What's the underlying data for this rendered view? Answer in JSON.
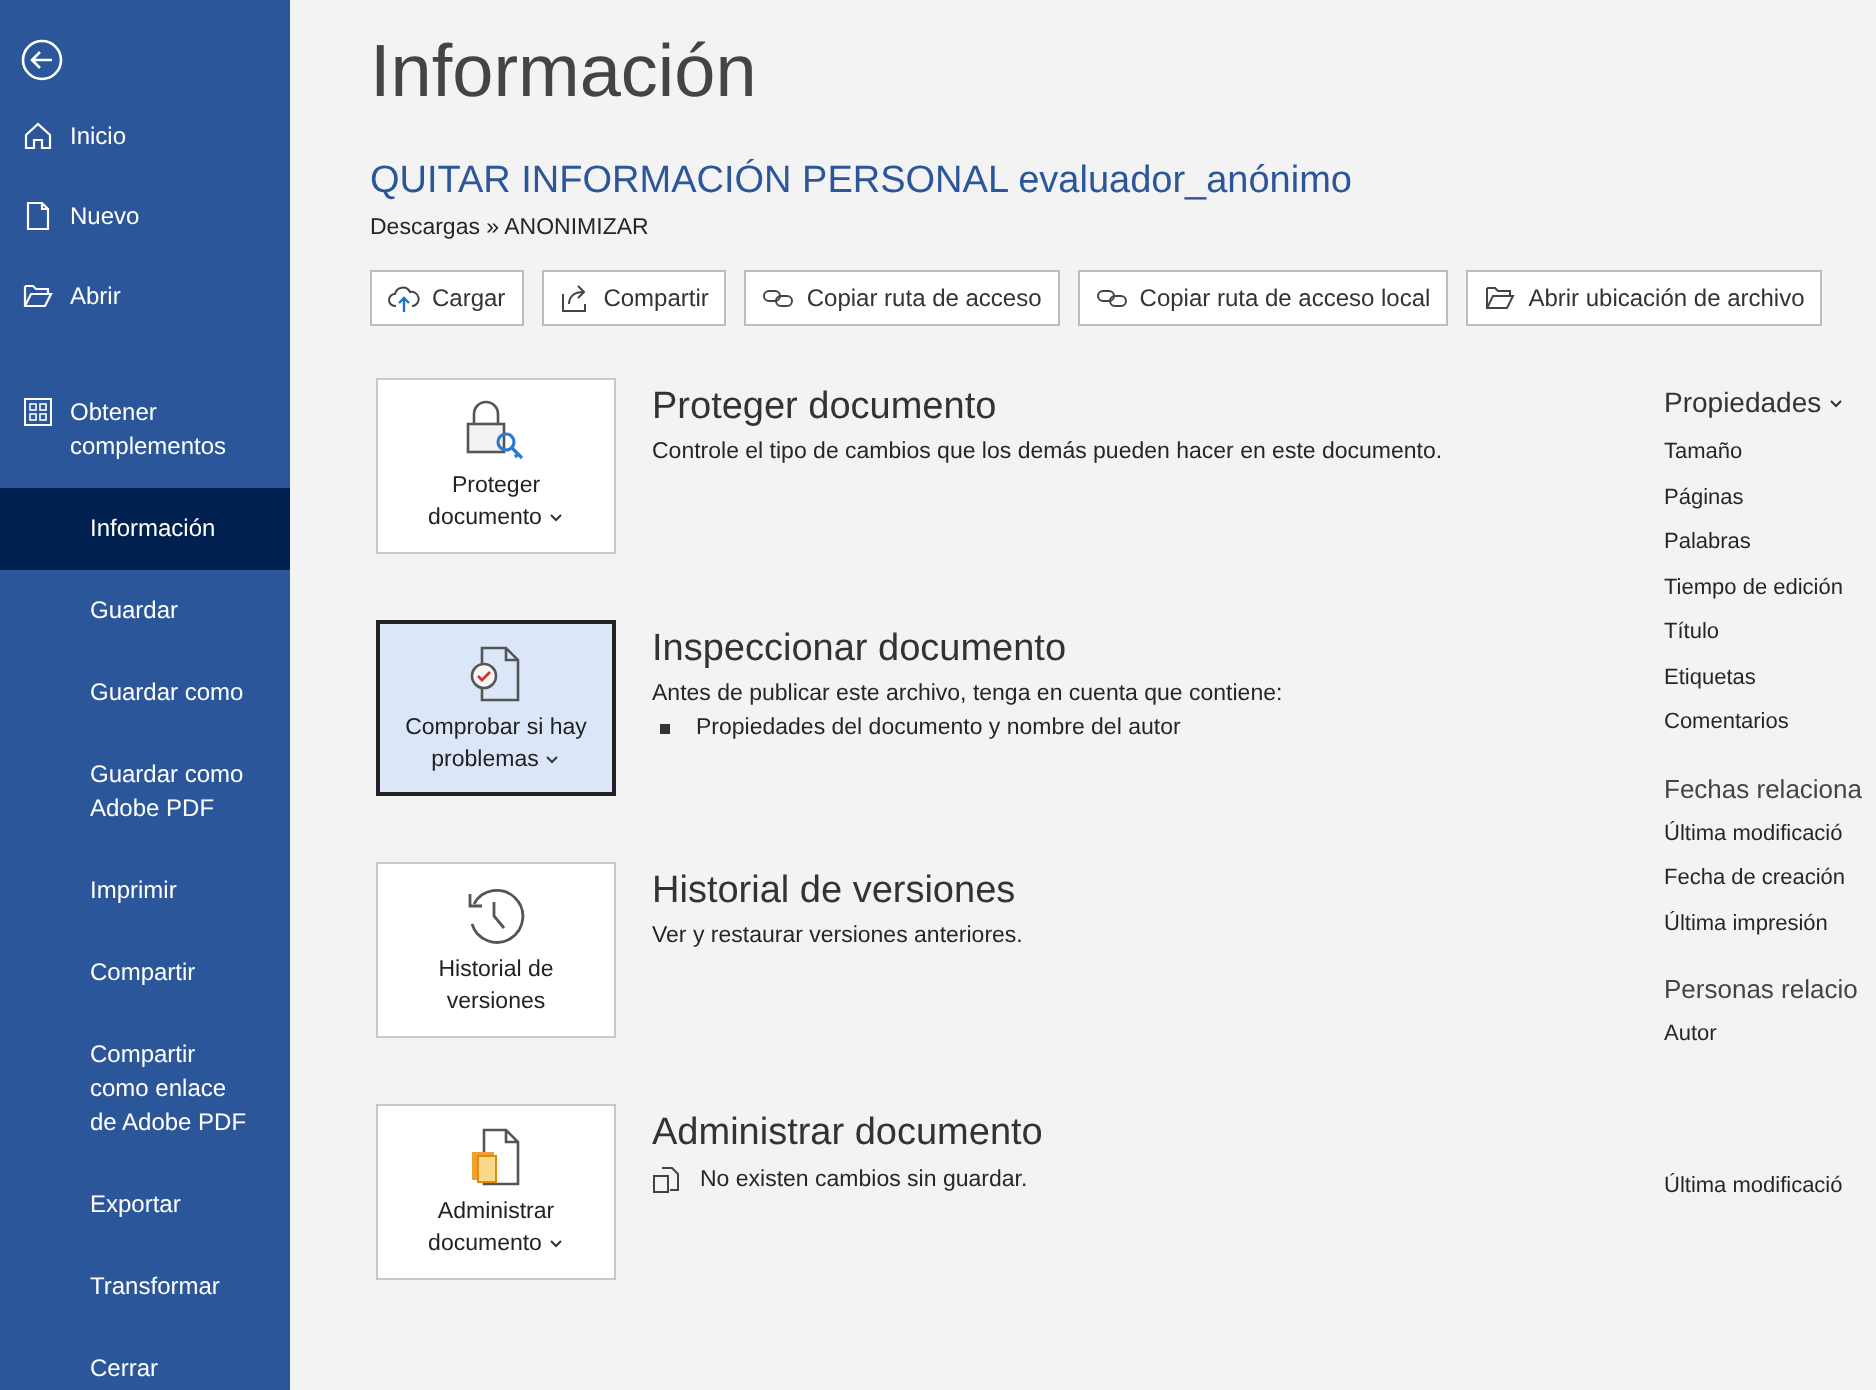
{
  "sidebar": {
    "top_items": [
      {
        "label": "Inicio",
        "kind": "home"
      },
      {
        "label": "Nuevo",
        "kind": "new"
      },
      {
        "label": "Abrir",
        "kind": "open"
      },
      {
        "label": "Obtener complementos",
        "kind": "addins"
      }
    ],
    "items": [
      {
        "label": "Información",
        "selected": true
      },
      {
        "label": "Guardar",
        "selected": false
      },
      {
        "label": "Guardar como",
        "selected": false
      },
      {
        "label": "Guardar como Adobe PDF",
        "selected": false
      },
      {
        "label": "Imprimir",
        "selected": false
      },
      {
        "label": "Compartir",
        "selected": false
      },
      {
        "label": "Compartir como enlace de Adobe PDF",
        "selected": false
      },
      {
        "label": "Exportar",
        "selected": false
      },
      {
        "label": "Transformar",
        "selected": false
      },
      {
        "label": "Cerrar",
        "selected": false
      }
    ]
  },
  "page_title": "Información",
  "document_title": "QUITAR INFORMACIÓN PERSONAL evaluador_anónimo",
  "path": "Descargas » ANONIMIZAR",
  "toolbar": [
    {
      "label": "Cargar",
      "kind": "upload"
    },
    {
      "label": "Compartir",
      "kind": "share"
    },
    {
      "label": "Copiar ruta de acceso",
      "kind": "link"
    },
    {
      "label": "Copiar ruta de acceso local",
      "kind": "link"
    },
    {
      "label": "Abrir ubicación de archivo",
      "kind": "folder"
    }
  ],
  "sections": [
    {
      "kind": "protect",
      "button": "Proteger documento",
      "dropdown": true,
      "selected": false,
      "title": "Proteger documento",
      "description": "Controle el tipo de cambios que los demás pueden hacer en este documento."
    },
    {
      "kind": "inspect",
      "button": "Comprobar si hay problemas",
      "dropdown": true,
      "selected": true,
      "title": "Inspeccionar documento",
      "description": "Antes de publicar este archivo, tenga en cuenta que contiene:",
      "bullets": [
        "Propiedades del documento y nombre del autor"
      ]
    },
    {
      "kind": "history",
      "button": "Historial de versiones",
      "dropdown": false,
      "selected": false,
      "title": "Historial de versiones",
      "description": "Ver y restaurar versiones anteriores."
    },
    {
      "kind": "manage",
      "button": "Administrar documento",
      "dropdown": true,
      "selected": false,
      "title": "Administrar documento",
      "status": "No existen cambios sin guardar."
    }
  ],
  "properties": {
    "title": "Propiedades",
    "items": [
      "Tamaño",
      "Páginas",
      "Palabras",
      "Tiempo de edición",
      "Título",
      "Etiquetas",
      "Comentarios"
    ]
  },
  "related_dates": {
    "title": "Fechas relaciona",
    "items": [
      "Última modificació",
      "Fecha de creación",
      "Última impresión"
    ]
  },
  "related_people": {
    "title": "Personas relacio",
    "items": [
      "Autor",
      "Última modificació"
    ]
  }
}
